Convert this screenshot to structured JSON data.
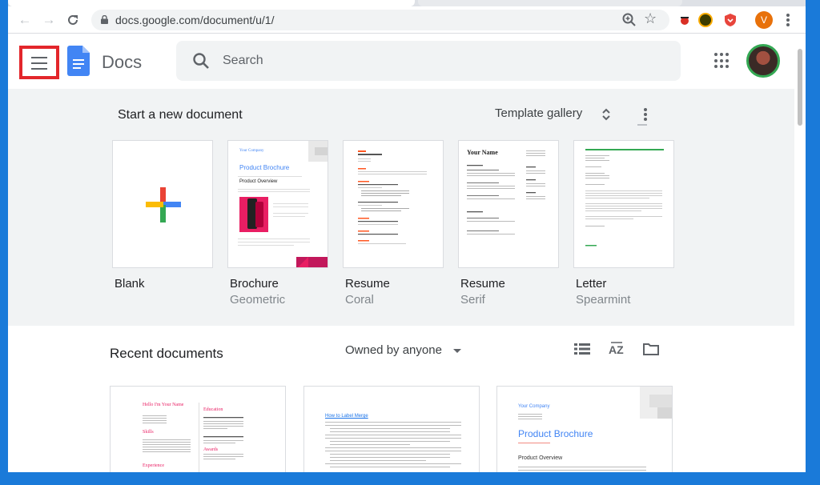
{
  "browser": {
    "url": "docs.google.com/document/u/1/",
    "profile_initial": "V"
  },
  "header": {
    "app_name": "Docs",
    "search_placeholder": "Search"
  },
  "new_document": {
    "title": "Start a new document",
    "template_gallery_label": "Template gallery",
    "templates": [
      {
        "name": "Blank",
        "subtitle": ""
      },
      {
        "name": "Brochure",
        "subtitle": "Geometric"
      },
      {
        "name": "Resume",
        "subtitle": "Coral"
      },
      {
        "name": "Resume",
        "subtitle": "Serif"
      },
      {
        "name": "Letter",
        "subtitle": "Spearmint"
      }
    ],
    "thumbnail_text": {
      "brochure_company": "Your Company",
      "brochure_title": "Product Brochure",
      "brochure_overview": "Product Overview",
      "serif_name": "Your Name",
      "recent_name": "Hello I'm Your Name",
      "recent_section1": "Education",
      "recent_section2": "Skills",
      "recent_section3": "Experience",
      "recent_section4": "Awards",
      "recent_link": "How to Label Merge",
      "recent_company": "Your Company",
      "recent_brochure": "Product Brochure",
      "recent_overview": "Product Overview"
    }
  },
  "recent": {
    "title": "Recent documents",
    "owner_filter": "Owned by anyone"
  },
  "colors": {
    "accent_blue": "#4285f4",
    "highlight_red": "#e3262b",
    "brochure_pink": "#e91e63",
    "coral": "#ff5722",
    "spearmint": "#34a853"
  }
}
